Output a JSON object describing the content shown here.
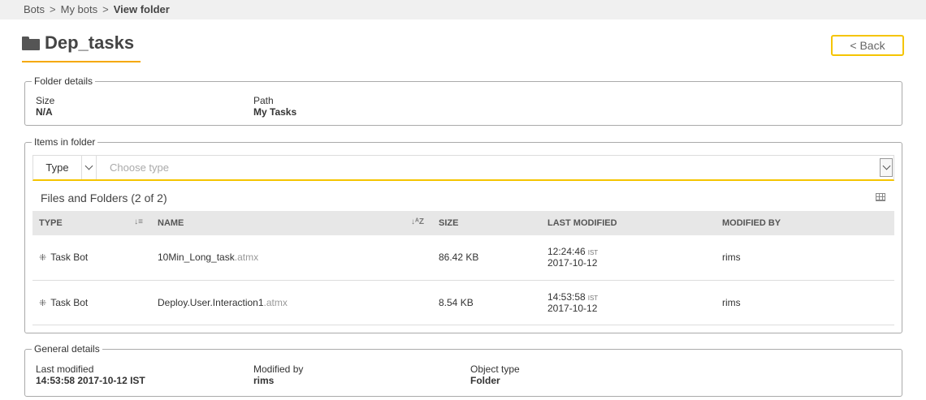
{
  "breadcrumb": {
    "items": [
      "Bots",
      "My bots"
    ],
    "current": "View folder",
    "separator": ">"
  },
  "header": {
    "title": "Dep_tasks",
    "icon": "folder-icon",
    "back_label": "< Back",
    "accent_color": "#f5a800"
  },
  "folder_details": {
    "legend": "Folder details",
    "size_label": "Size",
    "size_value": "N/A",
    "path_label": "Path",
    "path_value": "My Tasks"
  },
  "items": {
    "legend": "Items in folder",
    "filter": {
      "type_label": "Type",
      "placeholder": "Choose type"
    },
    "table_title": "Files and Folders (2 of 2)",
    "columns": [
      "Type",
      "Name",
      "Size",
      "Last modified",
      "Modified by"
    ],
    "rows": [
      {
        "type": "Task Bot",
        "name": "10Min_Long_task",
        "ext": ".atmx",
        "size": "86.42 KB",
        "time": "12:24:46",
        "tz": "IST",
        "date": "2017-10-12",
        "modified_by": "rims"
      },
      {
        "type": "Task Bot",
        "name": "Deploy.User.Interaction1",
        "ext": ".atmx",
        "size": "8.54 KB",
        "time": "14:53:58",
        "tz": "IST",
        "date": "2017-10-12",
        "modified_by": "rims"
      }
    ]
  },
  "general_details": {
    "legend": "General details",
    "last_modified_label": "Last modified",
    "last_modified_value": "14:53:58 2017-10-12 IST",
    "modified_by_label": "Modified by",
    "modified_by_value": "rims",
    "object_type_label": "Object type",
    "object_type_value": "Folder"
  }
}
